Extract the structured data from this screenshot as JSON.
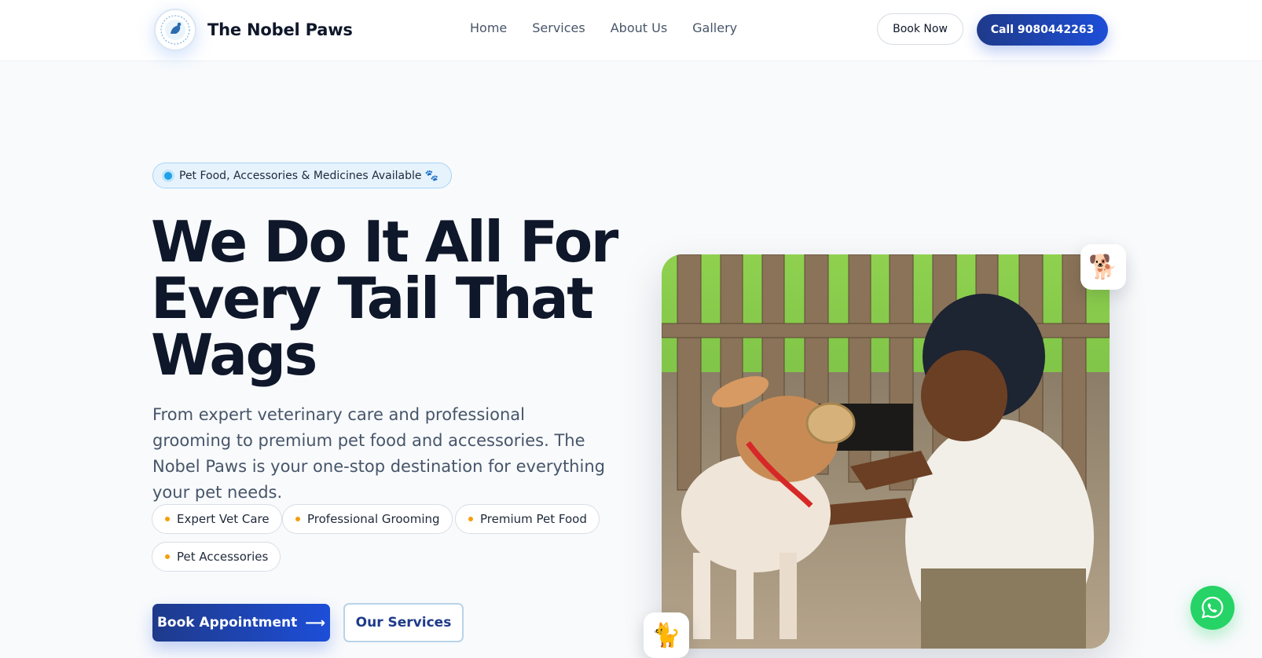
{
  "nav": {
    "brand": "The Nobel Paws",
    "links": [
      "Home",
      "Services",
      "About Us",
      "Gallery"
    ],
    "book_now": "Book Now",
    "call": "Call 9080442263"
  },
  "hero": {
    "badge": "Pet Food, Accessories & Medicines Available",
    "badge_emoji": "🐾",
    "headline_lines": [
      "We Do It All For",
      "Every Tail That",
      "Wags"
    ],
    "description": "From expert veterinary care and professional grooming to premium pet food and accessories. The Nobel Paws is your one-stop destination for everything your pet needs.",
    "chips": [
      "Expert Vet Care",
      "Professional Grooming",
      "Premium Pet Food",
      "Pet Accessories"
    ],
    "primary_button": "Book Appointment",
    "primary_arrow": "⟶",
    "secondary_button": "Our Services",
    "float_top_emoji": "🐕",
    "float_bottom_emoji": "🐈"
  },
  "colors": {
    "primary": "#1e3a8a",
    "accent_blue": "#1d4ed8",
    "chip_dot": "#f59e0b",
    "badge_dot": "#1ea1e9",
    "whatsapp": "#25d366"
  },
  "icons": {
    "logo": "paw-logo-icon",
    "whatsapp": "whatsapp-icon"
  }
}
